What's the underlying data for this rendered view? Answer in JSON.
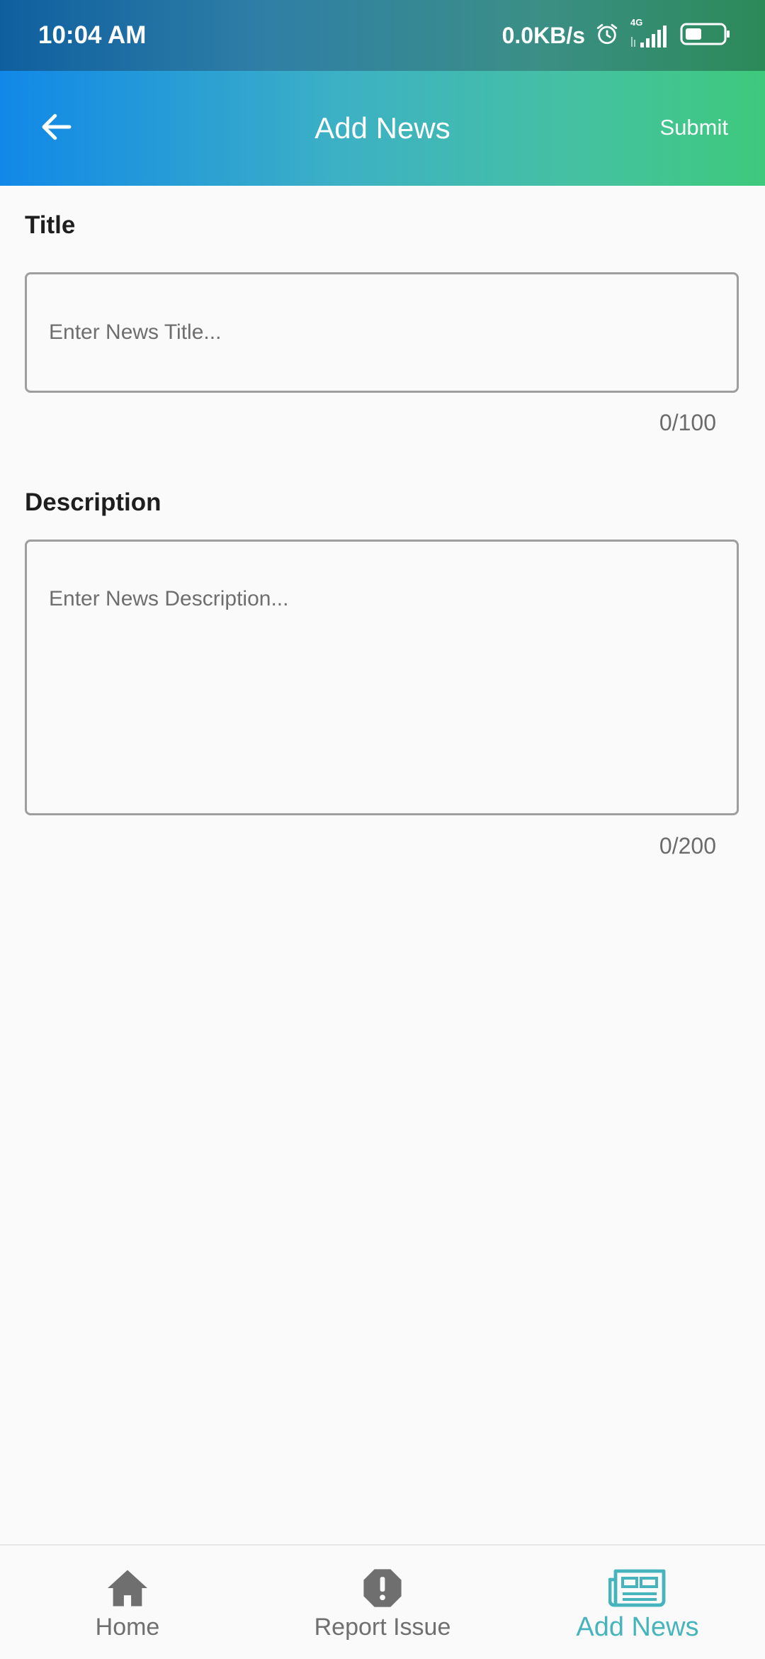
{
  "status_bar": {
    "time": "10:04 AM",
    "net_speed": "0.0KB/s",
    "network": "4G"
  },
  "app_bar": {
    "title": "Add News",
    "submit_label": "Submit"
  },
  "form": {
    "title": {
      "label": "Title",
      "placeholder": "Enter News Title...",
      "value": "",
      "counter": "0/100"
    },
    "description": {
      "label": "Description",
      "placeholder": "Enter News Description...",
      "value": "",
      "counter": "0/200"
    }
  },
  "bottom_nav": {
    "items": [
      {
        "label": "Home",
        "icon": "home-icon",
        "active": false
      },
      {
        "label": "Report Issue",
        "icon": "alert-octagon-icon",
        "active": false
      },
      {
        "label": "Add News",
        "icon": "newspaper-icon",
        "active": true
      }
    ]
  },
  "colors": {
    "accent": "#46b4bd",
    "inactive": "#6f6f6f",
    "appbar_start": "#1188e8",
    "appbar_end": "#3ec97c"
  }
}
